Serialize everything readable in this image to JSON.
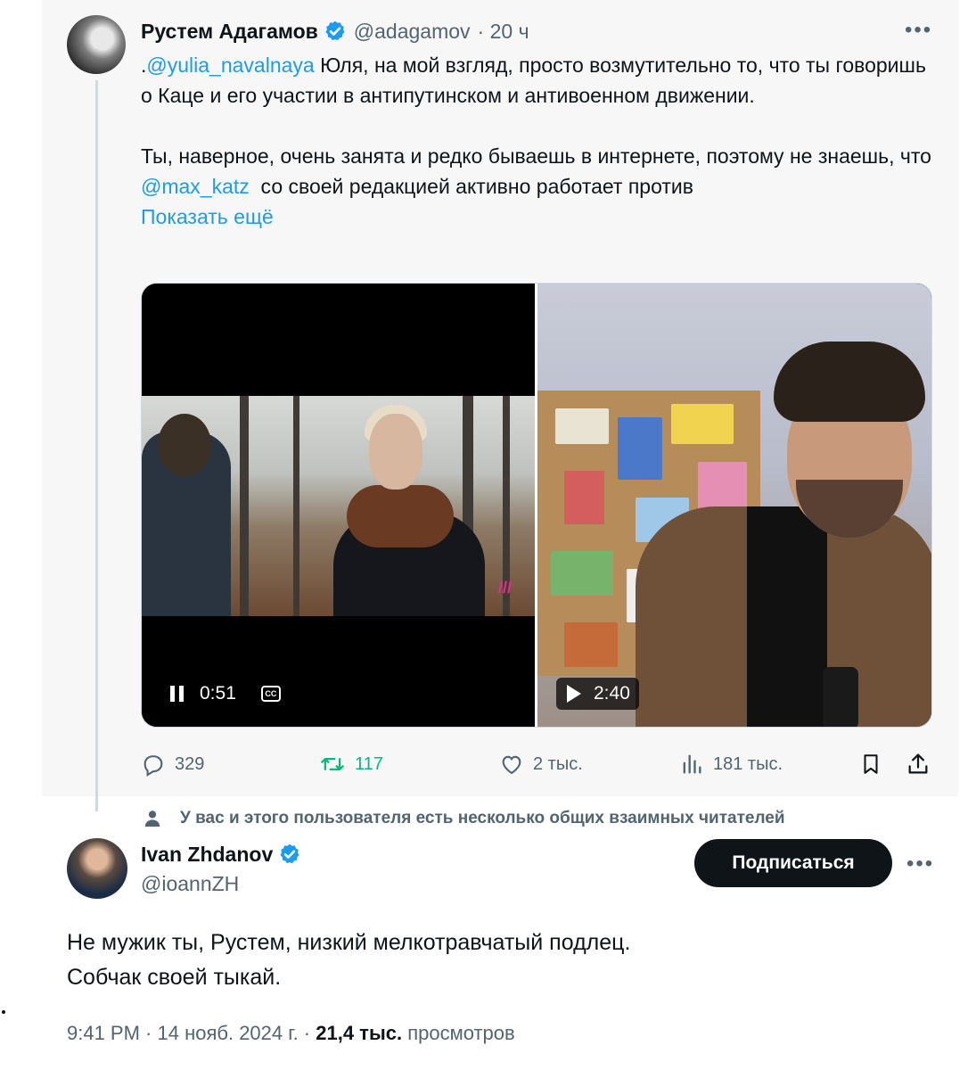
{
  "parent_tweet": {
    "author_name": "Рустем Адагамов",
    "handle": "@adagamov",
    "time": "· 20 ч",
    "more_label": "•••",
    "text": {
      "line1_prefix": ".",
      "mention1": "@yulia_navalnaya",
      "line1_rest": " Юля, на мой взгляд, просто возмутительно то, что ты говоришь о Каце и его участии в антипутинском и антивоенном движении.",
      "para2_start": "Ты, наверное, очень занята и редко бываешь в интернете, поэтому не знаешь, что ",
      "mention2": "@max_katz",
      "para2_end": "  со своей редакцией активно работает против",
      "show_more": "Показать ещё"
    },
    "media": {
      "left_video_time": "0:51",
      "left_cc_label": "CC",
      "left_logo": "///",
      "right_video_time": "2:40"
    },
    "actions": {
      "replies": "329",
      "retweets": "117",
      "likes": "2 тыс.",
      "views": "181 тыс."
    }
  },
  "mutual_notice": "У вас и этого пользователя есть несколько общих взаимных читателей",
  "reply_tweet": {
    "author_name": "Ivan Zhdanov",
    "handle": "@ioannZH",
    "follow_label": "Подписаться",
    "more_label": "•••",
    "line1": "Не мужик ты, Рустем, низкий мелкотравчатый подлец.",
    "line2": "Собчак своей тыкай.",
    "timestamp": "9:41 PM · 14 нояб. 2024 г. · ",
    "views_count": "21,4 тыс.",
    "views_label": " просмотров"
  },
  "colors": {
    "accent": "#1d9bf0",
    "retweet": "#00ba7c",
    "muted": "#536471",
    "text": "#0f1419"
  },
  "icons": [
    "verified-badge-icon",
    "more-icon",
    "pause-icon",
    "cc-icon",
    "play-icon",
    "reply-icon",
    "retweet-icon",
    "like-icon",
    "views-icon",
    "bookmark-icon",
    "share-icon",
    "person-icon"
  ]
}
